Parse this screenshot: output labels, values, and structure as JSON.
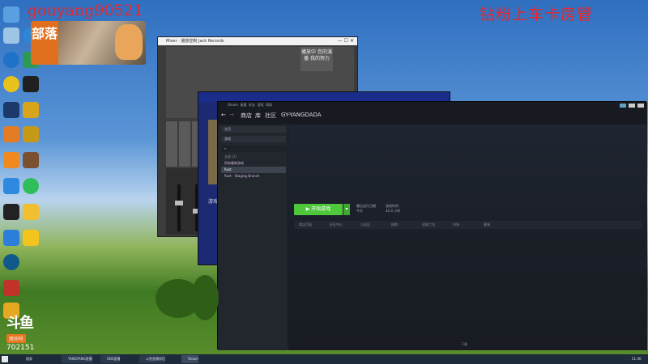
{
  "watermark": {
    "user": "gouyang90521",
    "slogan": "钻粉上车卡房管"
  },
  "promo": {
    "tag": "部落"
  },
  "douyu": {
    "logo": "斗鱼",
    "room_label": "房间号",
    "room_number": "702151"
  },
  "mixer": {
    "title": "Mixer · 播放控制 Jack Records",
    "side_button": "播放中 您的演播 我的努力",
    "colors": {
      "panel": "#4a4a4a"
    }
  },
  "steam_behind": {
    "caption": "游戏..."
  },
  "steam": {
    "menu": [
      "Steam",
      "查看",
      "好友",
      "游戏",
      "帮助"
    ],
    "nav": {
      "back": "←",
      "forward": "→",
      "store": "商店",
      "library": "库",
      "community": "社区",
      "username": "GY-YANGDADA"
    },
    "search_placeholder": "主页",
    "filter": "游戏",
    "library_group": "全部 (2)",
    "library_items": [
      "所有最新游戏",
      "Rust",
      "Rust - Staging Branch"
    ],
    "play_button": "开始游戏",
    "last_played_label": "最后运行日期",
    "last_played_value": "今天",
    "playtime_label": "游戏时间",
    "playtime_value": "42.4 小时",
    "tabs": [
      "商店页面",
      "社区中心",
      "讨论区",
      "指南",
      "创意工坊",
      "市场",
      "客服"
    ],
    "bottom_status": "下载",
    "colors": {
      "play": "#4ec83a",
      "bg": "#171d25",
      "sidebar": "#22262d"
    }
  },
  "taskbar": {
    "items": [
      "搜索",
      "YANGYANG直播",
      "OBS直播",
      "斗鱼直播伴侣",
      "Steam"
    ],
    "clock": "21:46"
  },
  "desktop_icons": [
    "此电脑",
    "回收站",
    "网络",
    "Internet Explorer",
    "360安全",
    "网易云",
    "Steam",
    "YY语音",
    "斗鱼直播",
    "腾讯QQ",
    "微信",
    "控制面板"
  ]
}
